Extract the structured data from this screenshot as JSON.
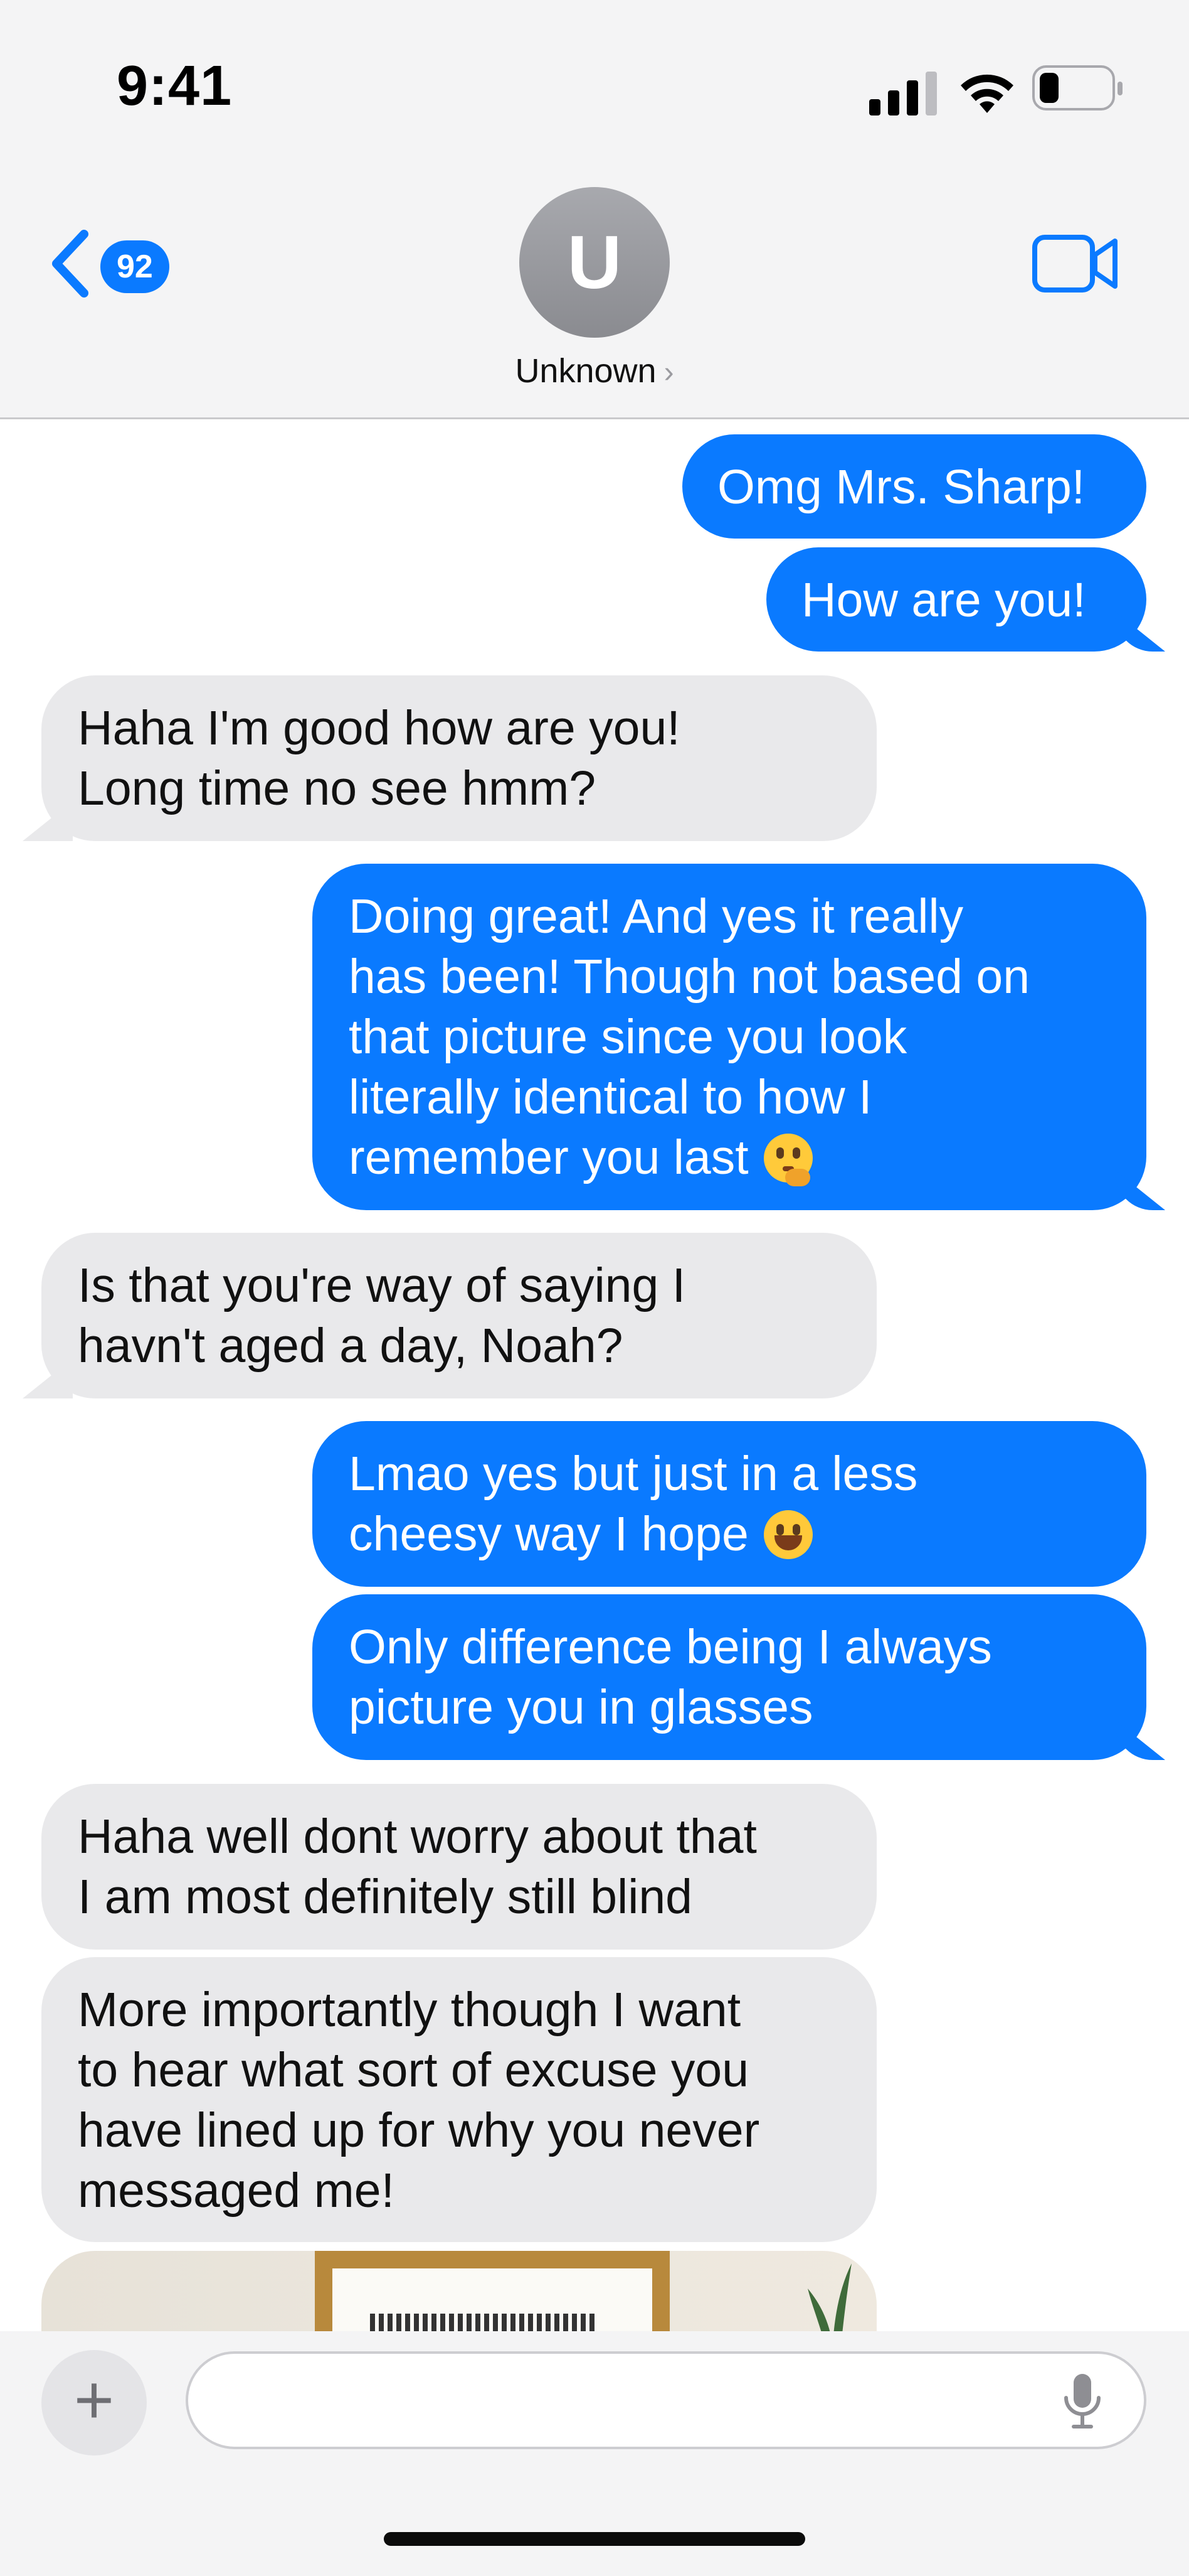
{
  "status_bar": {
    "time": "9:41"
  },
  "header": {
    "back_badge": "92",
    "avatar_initial": "U",
    "contact_name": "Unknown",
    "contact_chevron": "›"
  },
  "messages": [
    {
      "from": "me",
      "text": "Omg Mrs. Sharp!"
    },
    {
      "from": "me",
      "text": "How are you!"
    },
    {
      "from": "them",
      "text": "Haha I'm good how are you!\nLong time no see hmm?"
    },
    {
      "from": "me",
      "text": "Doing great! And yes it really\nhas been! Though not based on\nthat picture since you look\nliterally identical to how I\nremember you last",
      "emoji": "thinking-face"
    },
    {
      "from": "them",
      "text": "Is that you're way of saying I\nhavn't aged a day, Noah?"
    },
    {
      "from": "me",
      "text": "Lmao yes but just in a less\ncheesy way I hope",
      "emoji": "laughing-face"
    },
    {
      "from": "me",
      "text": "Only difference being I always\npicture you in glasses"
    },
    {
      "from": "them",
      "text": "Haha well dont worry about that\nI am most definitely still blind"
    },
    {
      "from": "them",
      "text": "More importantly though I want\nto hear what sort of excuse you\nhave lined up for why you never\nmessaged me!"
    }
  ],
  "composer": {
    "plus_label": "+",
    "placeholder": ""
  },
  "colors": {
    "outgoing": "#0a7aff",
    "incoming": "#e9e9eb",
    "accent": "#0a7aff"
  },
  "icons": [
    "signal-icon",
    "wifi-icon",
    "battery-icon",
    "back-chevron-icon",
    "video-camera-icon",
    "mic-icon"
  ]
}
